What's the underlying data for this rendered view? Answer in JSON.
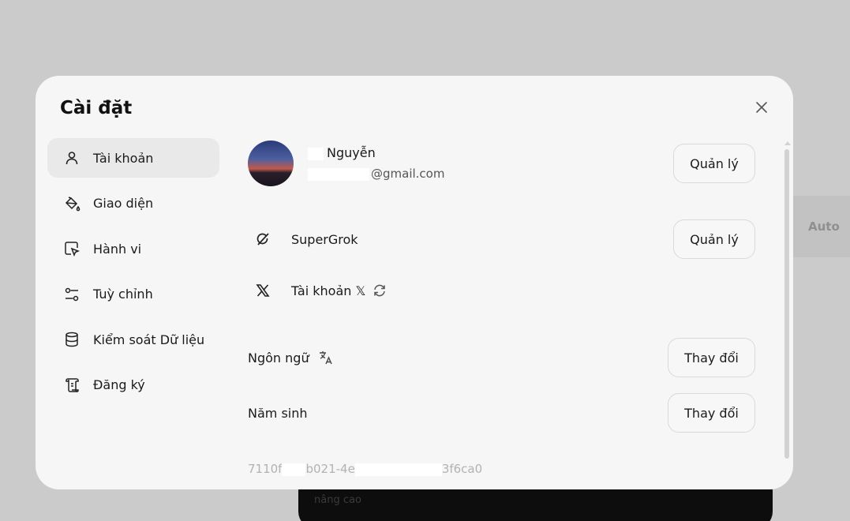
{
  "background": {
    "strip_label": "Auto",
    "composer_text": "nâng cao"
  },
  "modal": {
    "title": "Cài đặt"
  },
  "sidebar": {
    "items": [
      {
        "label": "Tài khoản",
        "icon": "user-icon"
      },
      {
        "label": "Giao diện",
        "icon": "paint-bucket-icon"
      },
      {
        "label": "Hành vi",
        "icon": "pointer-icon"
      },
      {
        "label": "Tuỳ chỉnh",
        "icon": "sliders-icon"
      },
      {
        "label": "Kiểm soát Dữ liệu",
        "icon": "database-icon"
      },
      {
        "label": "Đăng ký",
        "icon": "scroll-icon"
      }
    ]
  },
  "account": {
    "name": "Nguyễn",
    "email": "@gmail.com",
    "manage_label": "Quản lý"
  },
  "subscription": {
    "label": "SuperGrok",
    "manage_label": "Quản lý"
  },
  "x_account": {
    "label": "Tài khoản 𝕏"
  },
  "language": {
    "label": "Ngôn ngữ",
    "change_label": "Thay đổi"
  },
  "birth_year": {
    "label": "Năm sinh",
    "change_label": "Thay đổi"
  },
  "user_id": {
    "part1": "7110f",
    "part2": "b021-4e",
    "part3": "3f6ca0"
  }
}
